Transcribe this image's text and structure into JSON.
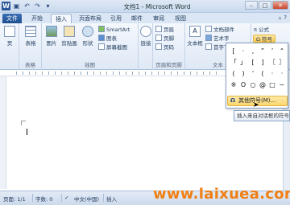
{
  "window": {
    "title": "文档1 - Microsoft Word",
    "app_icon": "W",
    "qat": [
      "save-icon",
      "undo-icon",
      "redo-icon",
      "customize-icon"
    ],
    "controls": [
      "–",
      "□",
      "✕"
    ]
  },
  "tabs": [
    {
      "label": "文件",
      "kind": "file"
    },
    {
      "label": "开始"
    },
    {
      "label": "插入",
      "active": true
    },
    {
      "label": "页面布局"
    },
    {
      "label": "引用"
    },
    {
      "label": "邮件"
    },
    {
      "label": "审阅"
    },
    {
      "label": "视图"
    }
  ],
  "ribbon": {
    "groups": [
      {
        "label": "",
        "buttons": [
          "页"
        ]
      },
      {
        "label": "表格",
        "buttons": [
          "表格"
        ]
      },
      {
        "label": "插图",
        "buttons": [
          "图片",
          "剪贴画",
          "形状",
          "SmartArt",
          "图表",
          "屏幕截图"
        ]
      },
      {
        "label": "",
        "buttons": [
          "链接"
        ]
      },
      {
        "label": "页眉和页脚",
        "buttons": [
          "页眉",
          "页脚",
          "页码"
        ]
      },
      {
        "label": "文本",
        "buttons": [
          "文本框",
          "文档部件",
          "艺术字",
          "首字下沉"
        ]
      },
      {
        "label": "",
        "buttons": [
          "公式",
          "符号"
        ]
      }
    ]
  },
  "symbols": [
    "[",
    "·",
    ",",
    "”",
    "’",
    "“",
    "「",
    "」",
    "[",
    "]",
    "〖",
    "〗",
    "(",
    ")",
    "‘",
    "(",
    "·",
    "·",
    "※",
    "O",
    "○",
    "@",
    "□",
    "~"
  ],
  "more_symbols_label": "其他符号(M)...",
  "tooltip": "插入来自对话框的符号",
  "status": {
    "page": "页面: 1/1",
    "words": "字数: 0",
    "lang": "中文(中国)",
    "mode": "插入"
  },
  "watermark": "www.laixuea.com"
}
